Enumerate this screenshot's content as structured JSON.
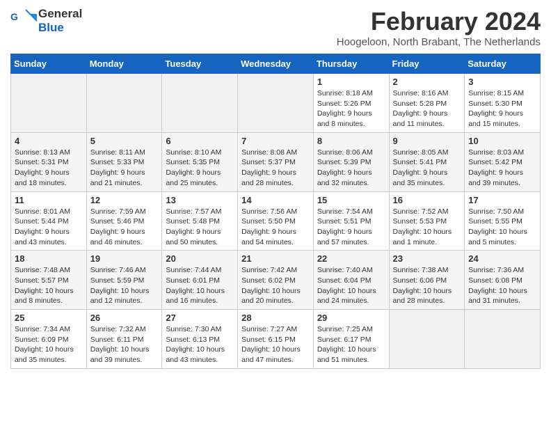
{
  "header": {
    "logo_line1": "General",
    "logo_line2": "Blue",
    "month": "February 2024",
    "location": "Hoogeloon, North Brabant, The Netherlands"
  },
  "weekdays": [
    "Sunday",
    "Monday",
    "Tuesday",
    "Wednesday",
    "Thursday",
    "Friday",
    "Saturday"
  ],
  "weeks": [
    [
      {
        "day": "",
        "info": ""
      },
      {
        "day": "",
        "info": ""
      },
      {
        "day": "",
        "info": ""
      },
      {
        "day": "",
        "info": ""
      },
      {
        "day": "1",
        "info": "Sunrise: 8:18 AM\nSunset: 5:26 PM\nDaylight: 9 hours\nand 8 minutes."
      },
      {
        "day": "2",
        "info": "Sunrise: 8:16 AM\nSunset: 5:28 PM\nDaylight: 9 hours\nand 11 minutes."
      },
      {
        "day": "3",
        "info": "Sunrise: 8:15 AM\nSunset: 5:30 PM\nDaylight: 9 hours\nand 15 minutes."
      }
    ],
    [
      {
        "day": "4",
        "info": "Sunrise: 8:13 AM\nSunset: 5:31 PM\nDaylight: 9 hours\nand 18 minutes."
      },
      {
        "day": "5",
        "info": "Sunrise: 8:11 AM\nSunset: 5:33 PM\nDaylight: 9 hours\nand 21 minutes."
      },
      {
        "day": "6",
        "info": "Sunrise: 8:10 AM\nSunset: 5:35 PM\nDaylight: 9 hours\nand 25 minutes."
      },
      {
        "day": "7",
        "info": "Sunrise: 8:08 AM\nSunset: 5:37 PM\nDaylight: 9 hours\nand 28 minutes."
      },
      {
        "day": "8",
        "info": "Sunrise: 8:06 AM\nSunset: 5:39 PM\nDaylight: 9 hours\nand 32 minutes."
      },
      {
        "day": "9",
        "info": "Sunrise: 8:05 AM\nSunset: 5:41 PM\nDaylight: 9 hours\nand 35 minutes."
      },
      {
        "day": "10",
        "info": "Sunrise: 8:03 AM\nSunset: 5:42 PM\nDaylight: 9 hours\nand 39 minutes."
      }
    ],
    [
      {
        "day": "11",
        "info": "Sunrise: 8:01 AM\nSunset: 5:44 PM\nDaylight: 9 hours\nand 43 minutes."
      },
      {
        "day": "12",
        "info": "Sunrise: 7:59 AM\nSunset: 5:46 PM\nDaylight: 9 hours\nand 46 minutes."
      },
      {
        "day": "13",
        "info": "Sunrise: 7:57 AM\nSunset: 5:48 PM\nDaylight: 9 hours\nand 50 minutes."
      },
      {
        "day": "14",
        "info": "Sunrise: 7:56 AM\nSunset: 5:50 PM\nDaylight: 9 hours\nand 54 minutes."
      },
      {
        "day": "15",
        "info": "Sunrise: 7:54 AM\nSunset: 5:51 PM\nDaylight: 9 hours\nand 57 minutes."
      },
      {
        "day": "16",
        "info": "Sunrise: 7:52 AM\nSunset: 5:53 PM\nDaylight: 10 hours\nand 1 minute."
      },
      {
        "day": "17",
        "info": "Sunrise: 7:50 AM\nSunset: 5:55 PM\nDaylight: 10 hours\nand 5 minutes."
      }
    ],
    [
      {
        "day": "18",
        "info": "Sunrise: 7:48 AM\nSunset: 5:57 PM\nDaylight: 10 hours\nand 8 minutes."
      },
      {
        "day": "19",
        "info": "Sunrise: 7:46 AM\nSunset: 5:59 PM\nDaylight: 10 hours\nand 12 minutes."
      },
      {
        "day": "20",
        "info": "Sunrise: 7:44 AM\nSunset: 6:01 PM\nDaylight: 10 hours\nand 16 minutes."
      },
      {
        "day": "21",
        "info": "Sunrise: 7:42 AM\nSunset: 6:02 PM\nDaylight: 10 hours\nand 20 minutes."
      },
      {
        "day": "22",
        "info": "Sunrise: 7:40 AM\nSunset: 6:04 PM\nDaylight: 10 hours\nand 24 minutes."
      },
      {
        "day": "23",
        "info": "Sunrise: 7:38 AM\nSunset: 6:06 PM\nDaylight: 10 hours\nand 28 minutes."
      },
      {
        "day": "24",
        "info": "Sunrise: 7:36 AM\nSunset: 6:08 PM\nDaylight: 10 hours\nand 31 minutes."
      }
    ],
    [
      {
        "day": "25",
        "info": "Sunrise: 7:34 AM\nSunset: 6:09 PM\nDaylight: 10 hours\nand 35 minutes."
      },
      {
        "day": "26",
        "info": "Sunrise: 7:32 AM\nSunset: 6:11 PM\nDaylight: 10 hours\nand 39 minutes."
      },
      {
        "day": "27",
        "info": "Sunrise: 7:30 AM\nSunset: 6:13 PM\nDaylight: 10 hours\nand 43 minutes."
      },
      {
        "day": "28",
        "info": "Sunrise: 7:27 AM\nSunset: 6:15 PM\nDaylight: 10 hours\nand 47 minutes."
      },
      {
        "day": "29",
        "info": "Sunrise: 7:25 AM\nSunset: 6:17 PM\nDaylight: 10 hours\nand 51 minutes."
      },
      {
        "day": "",
        "info": ""
      },
      {
        "day": "",
        "info": ""
      }
    ]
  ]
}
